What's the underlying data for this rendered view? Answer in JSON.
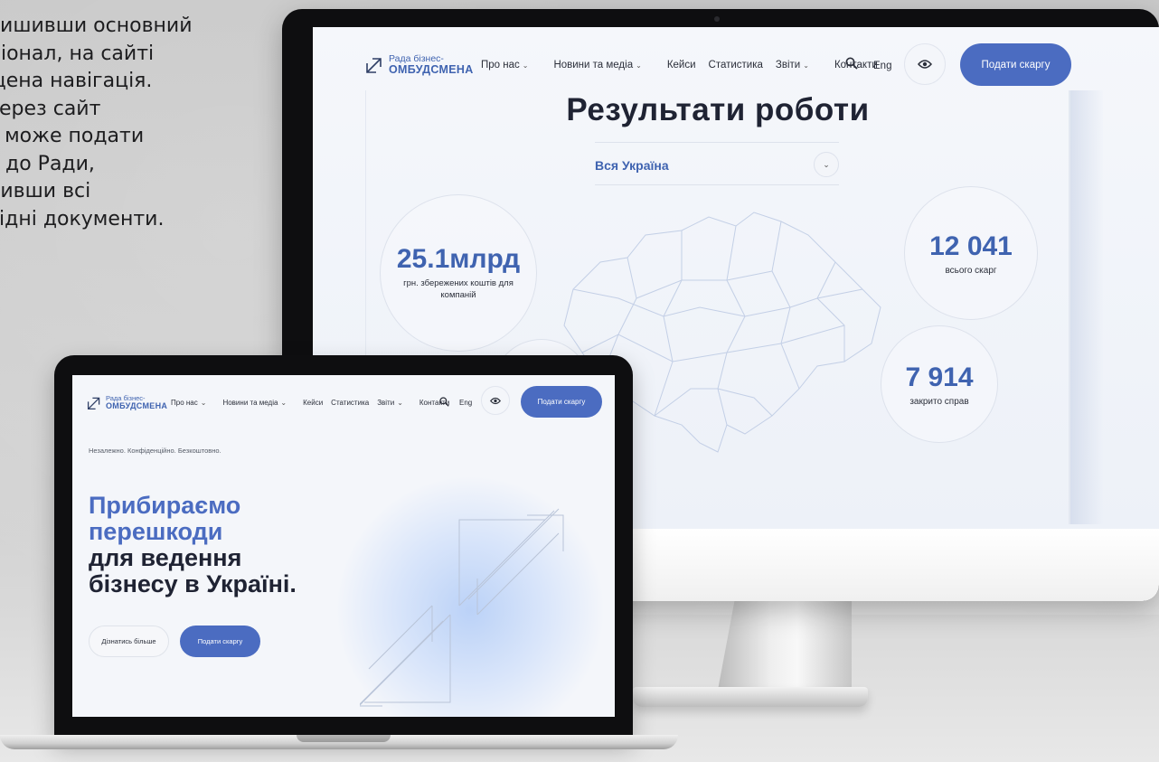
{
  "caption": {
    "lines": [
      "лишивши основний",
      "ціонал, на сайті",
      "щена навігація.",
      "через сайт",
      "с може подати",
      "у до Ради,",
      "нивши всі",
      "хідні документи."
    ]
  },
  "site": {
    "logo_line1": "Рада бізнес-",
    "logo_line2": "ОМБУДСМЕНА",
    "nav": {
      "about": "Про нас",
      "news": "Новини та медіа",
      "cases": "Кейси",
      "stats": "Статистика",
      "reports": "Звіти",
      "contacts": "Контакти"
    },
    "lang": "Eng",
    "cta": "Подати скаргу"
  },
  "monitor": {
    "title": "Результати роботи",
    "region_select": "Вся Україна",
    "stats": [
      {
        "value": "25.1млрд",
        "label": "грн. збережених коштів для компаній"
      },
      {
        "value": "12 041",
        "label": "всього скарг"
      },
      {
        "value": "7 914",
        "label": "закрито справ"
      }
    ]
  },
  "laptop": {
    "tagline": "Незалежно. Конфіденційно. Безкоштовно.",
    "hero_line1": "Прибираємо",
    "hero_line2": "перешкоди",
    "hero_line3": "для ведення",
    "hero_line4": "бізнесу в Україні.",
    "learn_more": "Дізнатись більше",
    "cta": "Подати скаргу"
  },
  "icons": {
    "logo": "diagonal-arrow-icon",
    "search": "search-icon",
    "eye": "eye-icon",
    "chevron": "chevron-down-icon"
  },
  "colors": {
    "brand_blue": "#4b6cc1",
    "text_dark": "#1f2333"
  }
}
